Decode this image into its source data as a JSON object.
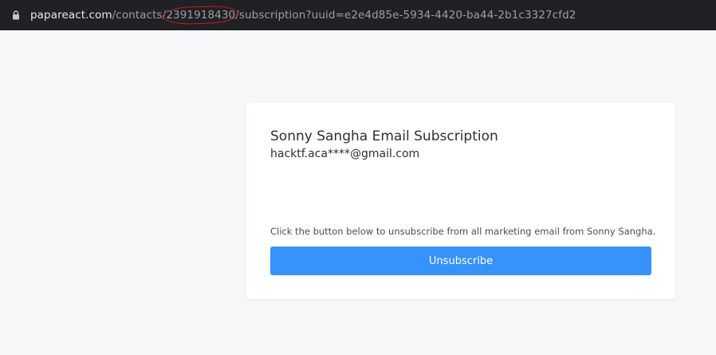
{
  "browser": {
    "url": {
      "domain": "papareact.com",
      "path_before": "/contacts/",
      "contact_id": "2391918430",
      "path_after": "/subscription?uuid=e2e4d85e-5934-4420-ba44-2b1c3327cfd2"
    },
    "icons": {
      "lock": "lock-icon"
    },
    "colors": {
      "toolbar_bg": "#202124",
      "highlight_annotation": "#d0181f"
    }
  },
  "card": {
    "title": "Sonny Sangha Email Subscription",
    "email": "hacktf.aca****@gmail.com",
    "note": "Click the button below to unsubscribe from all marketing email from Sonny Sangha.",
    "button_label": "Unsubscribe"
  },
  "colors": {
    "page_bg": "#f6f7f9",
    "button_bg": "#3593fb"
  }
}
